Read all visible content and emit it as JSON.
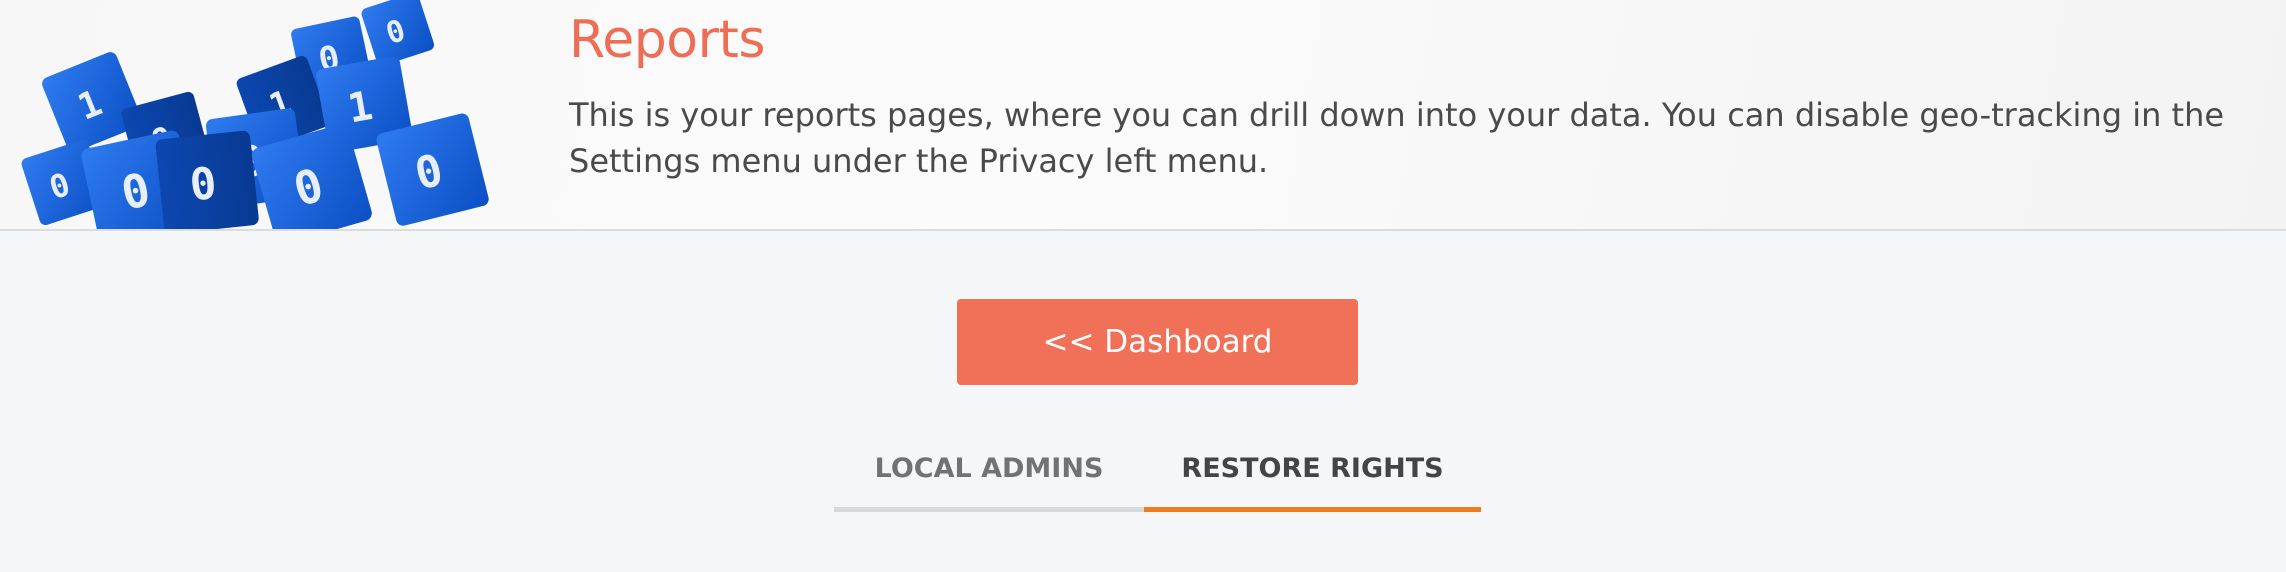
{
  "header": {
    "title": "Reports",
    "description": "This is your reports pages, where you can drill down into your data. You can disable geo-tracking in the Settings menu under the Privacy left menu.",
    "image_icon": "binary-cubes-image"
  },
  "actions": {
    "dashboard_label": "<< Dashboard"
  },
  "tabs": [
    {
      "label": "LOCAL ADMINS",
      "active": false
    },
    {
      "label": "RESTORE RIGHTS",
      "active": true
    }
  ],
  "colors": {
    "title": "#ee6e55",
    "button": "#f07158",
    "active_tab_underline": "#f07c22",
    "cube": "#1a62d8"
  }
}
